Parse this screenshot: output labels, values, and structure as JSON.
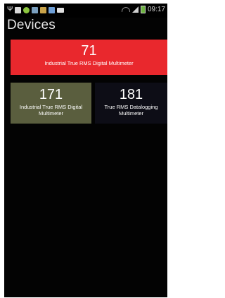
{
  "status_bar": {
    "time": "09:17",
    "icons": [
      "usb-icon",
      "sd-card-icon",
      "app-icon",
      "image-icon",
      "gallery-icon",
      "app-icon",
      "blackberry-icon",
      "wifi-icon",
      "signal-icon",
      "battery-icon"
    ]
  },
  "screen": {
    "title": "Devices"
  },
  "devices": [
    {
      "number": "71",
      "name": "Industrial True RMS Digital Multimeter",
      "color": "#e9282d"
    },
    {
      "number": "171",
      "name": "Industrial True RMS Digital Multimeter",
      "color": "#5a5e3e"
    },
    {
      "number": "181",
      "name": "True RMS Datalogging Multimeter",
      "color": "#0d0d16"
    }
  ]
}
